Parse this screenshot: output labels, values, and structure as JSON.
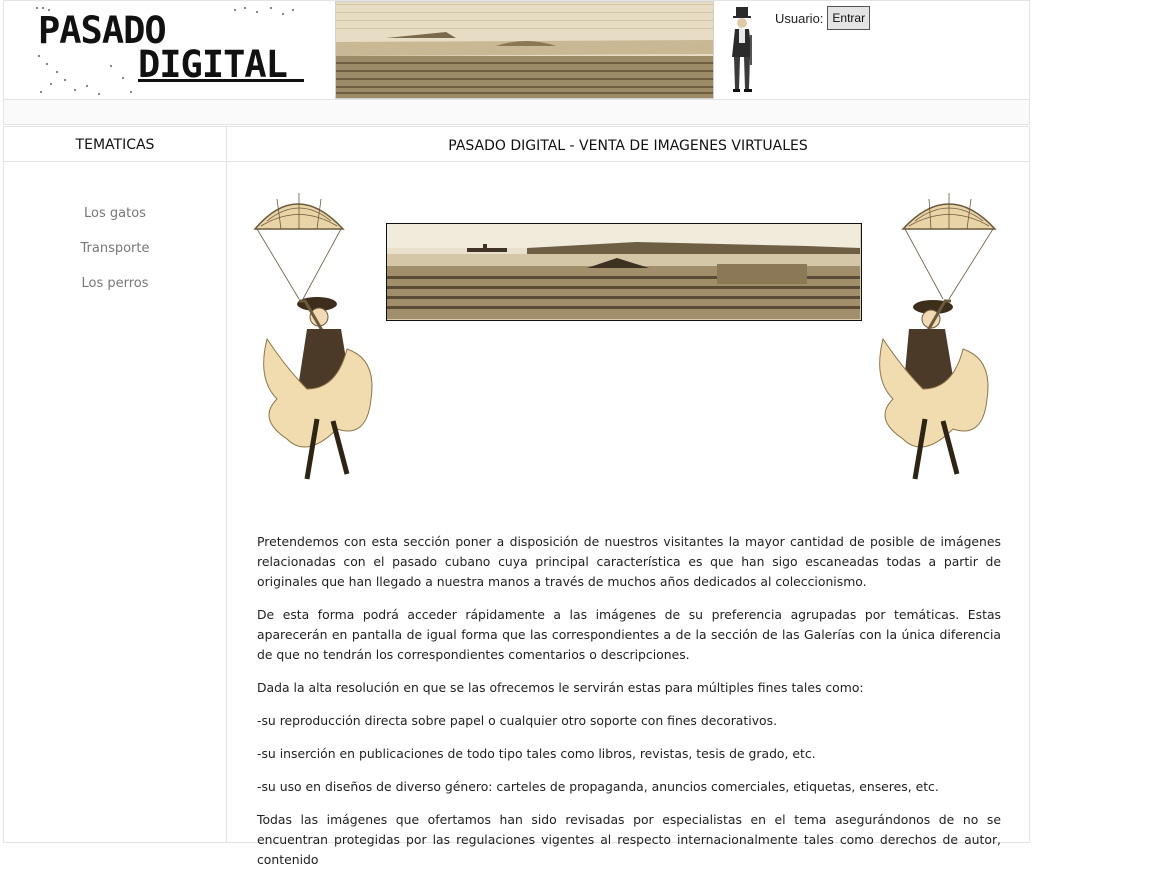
{
  "header": {
    "logo_text": "PASADO DIGITAL",
    "login": {
      "label": "Usuario:",
      "button_label": "Entrar"
    }
  },
  "sidebar": {
    "title": "TEMATICAS",
    "items": [
      {
        "label": "Los gatos"
      },
      {
        "label": "Transporte"
      },
      {
        "label": "Los perros"
      }
    ]
  },
  "main": {
    "title": "PASADO DIGITAL - VENTA DE IMAGENES VIRTUALES",
    "paragraphs": [
      "Pretendemos con esta sección poner a disposición de nuestros visitantes la mayor cantidad de posible de imágenes relacionadas con el pasado cubano cuya principal característica es que han sigo escaneadas todas a partir de originales que han llegado a nuestra manos a través de muchos años dedicados al coleccionismo.",
      "De esta forma podrá acceder rápidamente a las imágenes de su preferencia agrupadas por temáticas. Estas aparecerán en pantalla de igual forma que las correspondientes a de la sección de las Galerías con la única diferencia de que no tendrán los correspondientes comentarios o descripciones.",
      "Dada la alta resolución en que se las ofrecemos le servirán estas para múltiples fines tales como:",
      "-su reproducción directa sobre papel o cualquier otro soporte con fines decorativos.",
      "-su inserción en publicaciones de todo tipo tales como libros, revistas, tesis de grado, etc.",
      "-su uso en diseños de diverso género: carteles de propaganda,  anuncios comerciales, etiquetas, enseres, etc.",
      "Todas las imágenes que ofertamos han sido revisadas por especialistas en el tema asegurándonos de no se encuentran protegidas por las regulaciones vigentes al respecto internacionalmente tales como derechos de autor, contenido"
    ]
  },
  "colors": {
    "border": "#e4e4e4",
    "sepia_light": "#e8dcc2",
    "sepia_dark": "#5b4a32",
    "nav_text": "#777777"
  }
}
